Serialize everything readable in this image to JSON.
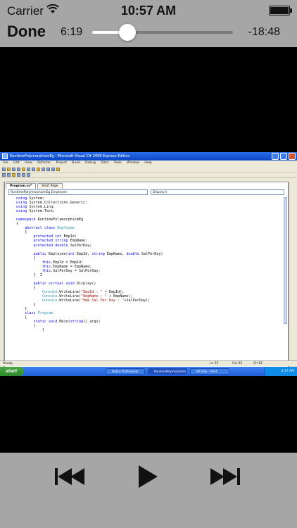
{
  "status_bar": {
    "carrier": "Carrier",
    "time": "10:57 AM",
    "battery_level": 1.0
  },
  "player": {
    "done_label": "Done",
    "elapsed": "6:19",
    "remaining": "-18:48",
    "progress": 0.25
  },
  "video_frame": {
    "window_title": "RuntimePolymorphismEg - Microsoft Visual C# 2008 Express Edition",
    "menu": [
      "File",
      "Edit",
      "View",
      "Refactor",
      "Project",
      "Build",
      "Debug",
      "Data",
      "Tools",
      "Window",
      "Help"
    ],
    "tabs": [
      "Program.cs*",
      "Start Page"
    ],
    "nav_left": "RuntimePolymorphismEg.Employee",
    "nav_right": "Display()",
    "status": {
      "ready": "Ready",
      "ln": "Ln 25",
      "col": "Col 62",
      "ch": "Ch 62"
    },
    "taskbar": {
      "start": "start",
      "tasks": [
        "Debut Professional",
        "RuntimePolymorphism...",
        "9II Step - Paint"
      ],
      "clock": "4:37 AM"
    }
  },
  "colors": {
    "bar_background": "#a6a6a6",
    "video_background": "#000000",
    "keyword": "#0000ff",
    "type": "#2b91af",
    "string": "#a31515"
  },
  "icons": {
    "previous": "rewind-icon",
    "play": "play-icon",
    "next": "fast-forward-icon"
  }
}
